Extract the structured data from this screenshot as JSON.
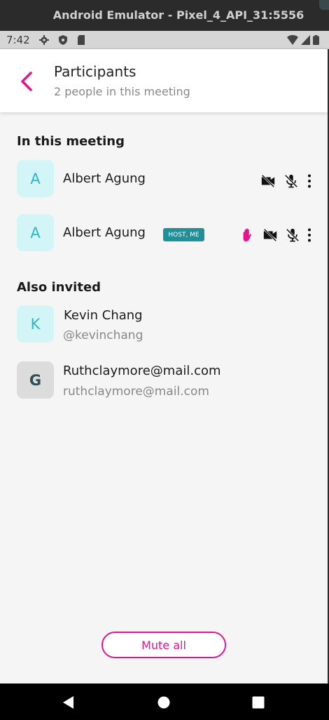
{
  "emulator": {
    "title": "Android Emulator - Pixel_4_API_31:5556"
  },
  "status_bar": {
    "time": "7:42"
  },
  "header": {
    "title": "Participants",
    "subtitle": "2 people in this meeting"
  },
  "in_meeting": {
    "title": "In this meeting",
    "participants": [
      {
        "initial": "A",
        "name": "Albert Agung",
        "badge": "",
        "hand_raised": false,
        "video_off": true,
        "mic_muted": true
      },
      {
        "initial": "A",
        "name": "Albert Agung",
        "badge": "HOST, ME",
        "hand_raised": true,
        "video_off": true,
        "mic_muted": true
      }
    ]
  },
  "also_invited": {
    "title": "Also invited",
    "people": [
      {
        "initial": "K",
        "name": "Kevin Chang",
        "handle": "@kevinchang"
      },
      {
        "initial": "G",
        "name": "Ruthclaymore@mail.com",
        "handle": "ruthclaymore@mail.com"
      }
    ]
  },
  "actions": {
    "mute_all": "Mute all"
  },
  "colors": {
    "accent": "#e6138d",
    "teal": "#2cb9c5",
    "badge": "#1f8f9a"
  },
  "icons": [
    "back-chevron-icon",
    "video-off-icon",
    "mic-off-icon",
    "more-vert-icon",
    "raised-hand-icon"
  ]
}
